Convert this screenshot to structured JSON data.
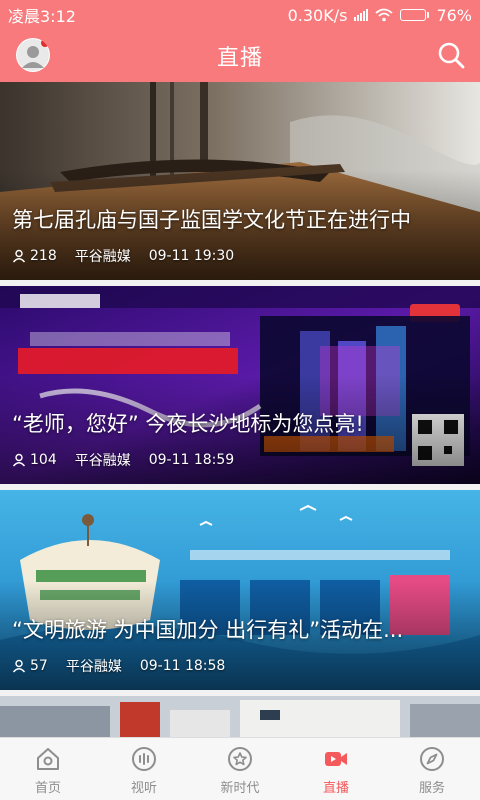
{
  "status_bar": {
    "time": "凌晨3:12",
    "network_speed": "0.30K/s",
    "battery_level": "76%",
    "battery_fraction": 0.76
  },
  "header": {
    "title": "直播",
    "avatar_icon": "user-avatar-icon",
    "search_icon": "search-icon"
  },
  "feed": [
    {
      "title": "第七届孔庙与国子监国学文化节正在进行中",
      "viewers": "218",
      "source": "平谷融媒",
      "time": "09-11 19:30"
    },
    {
      "title": "“老师，您好” 今夜长沙地标为您点亮!",
      "viewers": "104",
      "source": "平谷融媒",
      "time": "09-11 18:59"
    },
    {
      "title": "“文明旅游 为中国加分 出行有礼”活动在...",
      "viewers": "57",
      "source": "平谷融媒",
      "time": "09-11 18:58"
    }
  ],
  "tabs": [
    {
      "label": "首页",
      "icon": "home-icon",
      "active": false
    },
    {
      "label": "视听",
      "icon": "audio-wave-icon",
      "active": false
    },
    {
      "label": "新时代",
      "icon": "star-badge-icon",
      "active": false
    },
    {
      "label": "直播",
      "icon": "video-camera-icon",
      "active": true
    },
    {
      "label": "服务",
      "icon": "compass-icon",
      "active": false
    }
  ],
  "colors": {
    "brand": "#f87a7c",
    "tab_active": "#f45a5c",
    "tab_inactive": "#8e8e8e"
  }
}
